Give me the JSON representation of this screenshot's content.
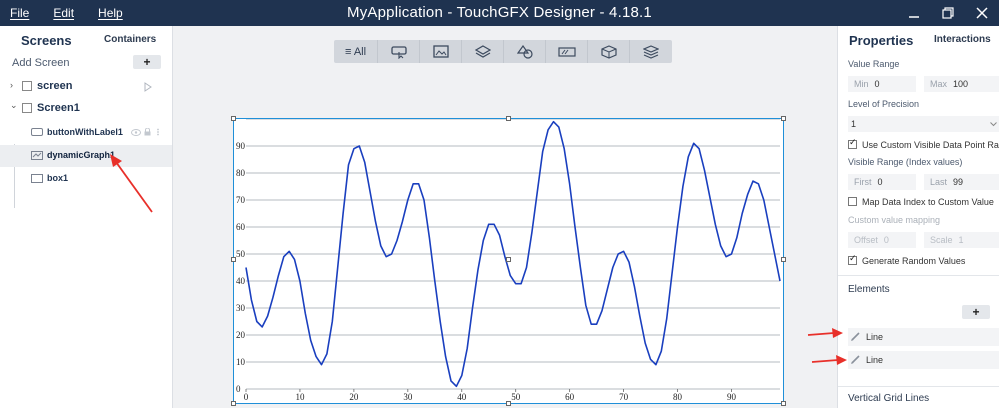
{
  "app": {
    "title": "MyApplication - TouchGFX Designer - 4.18.1",
    "menu": [
      "File",
      "Edit",
      "Help"
    ]
  },
  "left_panel": {
    "tab_screens": "Screens",
    "tab_containers": "Containers",
    "add_screen": "Add Screen",
    "add_button": "+",
    "tree": [
      {
        "label": "screen",
        "level": 0,
        "chevron": "›"
      },
      {
        "label": "Screen1",
        "level": 0,
        "chevron": "⌄"
      },
      {
        "label": "buttonWithLabel1",
        "level": 1
      },
      {
        "label": "dynamicGraph1",
        "level": 1,
        "selected": true
      },
      {
        "label": "box1",
        "level": 1
      }
    ]
  },
  "toolbar": {
    "all_label": "≡ All",
    "icons": [
      "button-icon",
      "image-icon",
      "layers-icon",
      "shapes-icon",
      "progress-icon",
      "box3d-icon",
      "stack-icon"
    ]
  },
  "chart_data": {
    "type": "line",
    "title": "",
    "xlabel": "",
    "ylabel": "",
    "xlim": [
      0,
      99
    ],
    "ylim": [
      0,
      100
    ],
    "x_ticks": [
      0,
      10,
      20,
      30,
      40,
      50,
      60,
      70,
      80,
      90
    ],
    "y_ticks": [
      0,
      10,
      20,
      30,
      40,
      50,
      60,
      70,
      80,
      90
    ],
    "grid": "horizontal",
    "color": "#1a3fbf",
    "series": [
      {
        "values": [
          45,
          33,
          25,
          23,
          27,
          34,
          42,
          49,
          51,
          48,
          40,
          28,
          18,
          12,
          9,
          13,
          25,
          45,
          65,
          83,
          89,
          90,
          84,
          73,
          62,
          53,
          49,
          50,
          55,
          62,
          70,
          76,
          76,
          70,
          56,
          40,
          25,
          12,
          3,
          1,
          5,
          15,
          30,
          44,
          55,
          61,
          61,
          57,
          49,
          42,
          39,
          39,
          45,
          58,
          73,
          88,
          96,
          99,
          97,
          89,
          76,
          60,
          45,
          31,
          24,
          24,
          29,
          37,
          45,
          50,
          51,
          47,
          38,
          27,
          17,
          11,
          9,
          14,
          26,
          43,
          60,
          75,
          86,
          91,
          89,
          81,
          71,
          61,
          53,
          49,
          50,
          56,
          65,
          72,
          77,
          76,
          70,
          60,
          50,
          40
        ]
      }
    ]
  },
  "right_panel": {
    "title": "Properties",
    "tab_interactions": "Interactions",
    "value_range_label": "Value Range",
    "min_key": "Min",
    "min_val": "0",
    "max_key": "Max",
    "max_val": "100",
    "precision_label": "Level of Precision",
    "precision_val": "1",
    "custom_visible_label": "Use Custom Visible Data Point Range",
    "visible_range_label": "Visible Range (Index values)",
    "first_key": "First",
    "first_val": "0",
    "last_key": "Last",
    "last_val": "99",
    "map_index_label": "Map Data Index to Custom Value",
    "custom_mapping_label": "Custom value mapping",
    "offset_key": "Offset",
    "offset_val": "0",
    "scale_key": "Scale",
    "scale_val": "1",
    "random_label": "Generate Random Values",
    "elements_label": "Elements",
    "elements_add": "+",
    "elements": [
      "Line",
      "Line"
    ],
    "vgrid_label": "Vertical Grid Lines"
  }
}
